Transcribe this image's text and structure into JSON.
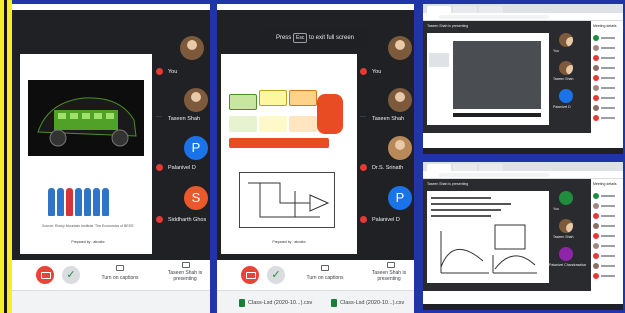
{
  "colors": {
    "accent_border": "#1f35a8",
    "stripe": "#f4ef2a",
    "meet_bg": "#202124",
    "end_call": "#ea4335"
  },
  "panel1": {
    "participants": [
      {
        "name": "You",
        "avatar": "photo"
      },
      {
        "name": "Taseen Shah",
        "avatar": "photo"
      },
      {
        "name": "Palanivel D",
        "avatar": "P"
      },
      {
        "name": "Siddharth Ghos",
        "avatar": "S"
      }
    ],
    "slide": {
      "source": "Source: Rocky Mountain Institute 'The Economics of BESS'",
      "prepared": "Prepared by : abcabc"
    },
    "controls": {
      "captions_label": "Turn on captions",
      "presenting_label": "Taseen Shah is presenting"
    }
  },
  "panel2": {
    "fullscreen_prefix": "Press",
    "fullscreen_key": "Esc",
    "fullscreen_suffix": "to exit full screen",
    "participants": [
      {
        "name": "You",
        "avatar": "photo"
      },
      {
        "name": "Taseen Shah",
        "avatar": "photo"
      },
      {
        "name": "Dr.S. Srinath",
        "avatar": "photo"
      },
      {
        "name": "Palanivel D",
        "avatar": "P"
      }
    ],
    "slide": {
      "prepared": "Prepared by : abcabc"
    },
    "controls": {
      "captions_label": "Turn on captions",
      "presenting_label": "Taseen Shah is presenting"
    },
    "downloads": [
      "Class-Lsd (2020-10...).csv",
      "Class-Lsd (2020-10...).csv"
    ]
  },
  "panel3": {
    "presenting": "Taseen Shah is presenting",
    "side_title": "Meeting details",
    "participants": [
      "You",
      "Taseen Shah",
      "Palanivel D"
    ]
  },
  "panel4": {
    "presenting": "Taseen Shah is presenting",
    "side_title": "Meeting details",
    "participants": [
      "You",
      "Taseen Shah",
      "Palanivel Chandrasekar"
    ]
  }
}
